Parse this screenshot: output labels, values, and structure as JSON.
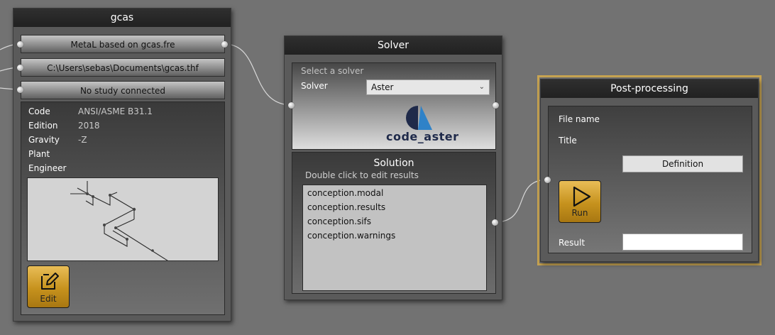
{
  "gcas": {
    "title": "gcas",
    "input_material": "MetaL based on gcas.fre",
    "input_file": "C:\\Users\\sebas\\Documents\\gcas.thf",
    "study_status": "No study connected",
    "properties": [
      {
        "label": "Code",
        "value": "ANSI/ASME B31.1"
      },
      {
        "label": "Edition",
        "value": "2018"
      },
      {
        "label": "Gravity",
        "value": "-Z"
      },
      {
        "label": "Plant",
        "value": ""
      },
      {
        "label": "Engineer",
        "value": ""
      }
    ],
    "edit_label": "Edit",
    "edit_icon": "edit-icon"
  },
  "solver": {
    "title": "Solver",
    "hint": "Select a solver",
    "solver_label": "Solver",
    "solver_value": "Aster",
    "logo_text": "code_aster",
    "solution_title": "Solution",
    "solution_hint": "Double click to edit results",
    "results": [
      "conception.modal",
      "conception.results",
      "conception.sifs",
      "conception.warnings"
    ]
  },
  "post": {
    "title": "Post-processing",
    "file_name_label": "File name",
    "title_label": "Title",
    "definition_button": "Definition",
    "run_label": "Run",
    "run_icon": "play-icon",
    "result_label": "Result",
    "result_value": ""
  },
  "colors": {
    "background": "#727272",
    "node_title": "#262626",
    "gold": "#c6921d",
    "selected_border": "#c9a552",
    "logo_dark": "#1f2a4a",
    "logo_blue": "#2f82c8"
  }
}
